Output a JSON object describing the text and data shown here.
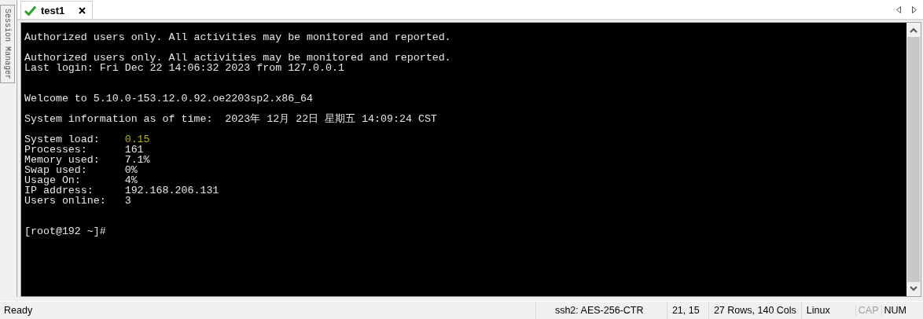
{
  "side_panel": {
    "label": "Session Manager"
  },
  "tabs": [
    {
      "label": "test1",
      "selected": true,
      "connected": true
    }
  ],
  "terminal": {
    "lines": [
      {
        "kind": "text",
        "text": "Authorized users only. All activities may be monitored and reported."
      },
      {
        "kind": "blank"
      },
      {
        "kind": "text",
        "text": "Authorized users only. All activities may be monitored and reported."
      },
      {
        "kind": "text",
        "text": "Last login: Fri Dec 22 14:06:32 2023 from 127.0.0.1"
      },
      {
        "kind": "blank"
      },
      {
        "kind": "blank"
      },
      {
        "kind": "text",
        "text": "Welcome to 5.10.0-153.12.0.92.oe2203sp2.x86_64"
      },
      {
        "kind": "blank"
      },
      {
        "kind": "text",
        "text": "System information as of time:  2023年 12月 22日 星期五 14:09:24 CST"
      },
      {
        "kind": "blank"
      },
      {
        "kind": "stat",
        "label": "System load:",
        "value": "0.15",
        "color": "#b4b400"
      },
      {
        "kind": "stat",
        "label": "Processes:",
        "value": "161",
        "color": "#e6e6e6"
      },
      {
        "kind": "stat",
        "label": "Memory used:",
        "value": "7.1%",
        "color": "#e6e6e6"
      },
      {
        "kind": "stat",
        "label": "Swap used:",
        "value": "0%",
        "color": "#e6e6e6"
      },
      {
        "kind": "stat",
        "label": "Usage On:",
        "value": "4%",
        "color": "#e6e6e6"
      },
      {
        "kind": "stat",
        "label": "IP address:",
        "value": "192.168.206.131",
        "color": "#e6e6e6"
      },
      {
        "kind": "stat",
        "label": "Users online:",
        "value": "3",
        "color": "#e6e6e6"
      },
      {
        "kind": "blank"
      },
      {
        "kind": "blank"
      },
      {
        "kind": "text",
        "text": "[root@192 ~]#"
      }
    ]
  },
  "status_bar": {
    "message": "Ready",
    "cipher": "ssh2: AES-256-CTR",
    "cursor": "21,  15",
    "size": "27 Rows, 140 Cols",
    "os": "Linux",
    "indicators": [
      {
        "label": "CAP",
        "on": false
      },
      {
        "label": "NUM",
        "on": true
      }
    ]
  }
}
